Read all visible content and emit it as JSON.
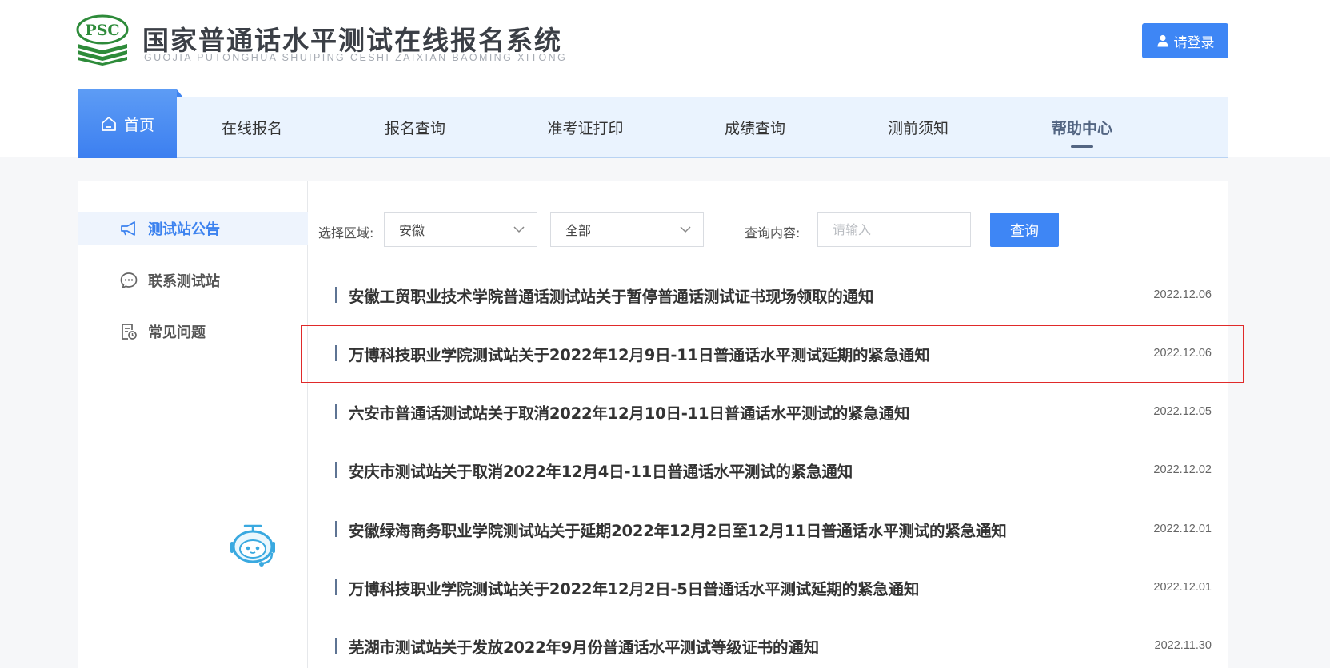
{
  "header": {
    "logo_abbr": "PSC",
    "title": "国家普通话水平测试在线报名系统",
    "subtitle": "GUOJIA PUTONGHUA SHUIPING CESHI ZAIXIAN BAOMING XITONG",
    "login_label": "请登录",
    "brand_color": "#3e86f5"
  },
  "nav": {
    "items": [
      {
        "label": "首页",
        "icon": "home-icon",
        "active": true
      },
      {
        "label": "在线报名"
      },
      {
        "label": "报名查询"
      },
      {
        "label": "准考证打印"
      },
      {
        "label": "成绩查询"
      },
      {
        "label": "测前须知"
      },
      {
        "label": "帮助中心",
        "current": true
      }
    ]
  },
  "sidebar": {
    "items": [
      {
        "label": "测试站公告",
        "icon": "megaphone-icon",
        "active": true
      },
      {
        "label": "联系测试站",
        "icon": "chat-bubble-icon"
      },
      {
        "label": "常见问题",
        "icon": "document-clock-icon"
      }
    ],
    "assistant_icon": "robot-assistant-icon"
  },
  "filter": {
    "region_label": "选择区域:",
    "region_value": "安徽",
    "scope_value": "全部",
    "query_label": "查询内容:",
    "query_placeholder": "请输入",
    "query_button": "查询"
  },
  "notices": [
    {
      "title": "安徽工贸职业技术学院普通话测试站关于暂停普通话测试证书现场领取的通知",
      "date": "2022.12.06"
    },
    {
      "title": "万博科技职业学院测试站关于2022年12月9日-11日普通话水平测试延期的紧急通知",
      "date": "2022.12.06",
      "highlighted": true
    },
    {
      "title": "六安市普通话测试站关于取消2022年12月10日-11日普通话水平测试的紧急通知",
      "date": "2022.12.05"
    },
    {
      "title": "安庆市测试站关于取消2022年12月4日-11日普通话水平测试的紧急通知",
      "date": "2022.12.02"
    },
    {
      "title": "安徽绿海商务职业学院测试站关于延期2022年12月2日至12月11日普通话水平测试的紧急通知",
      "date": "2022.12.01"
    },
    {
      "title": "万博科技职业学院测试站关于2022年12月2日-5日普通话水平测试延期的紧急通知",
      "date": "2022.12.01"
    },
    {
      "title": "芜湖市测试站关于发放2022年9月份普通话水平测试等级证书的通知",
      "date": "2022.11.30"
    }
  ]
}
